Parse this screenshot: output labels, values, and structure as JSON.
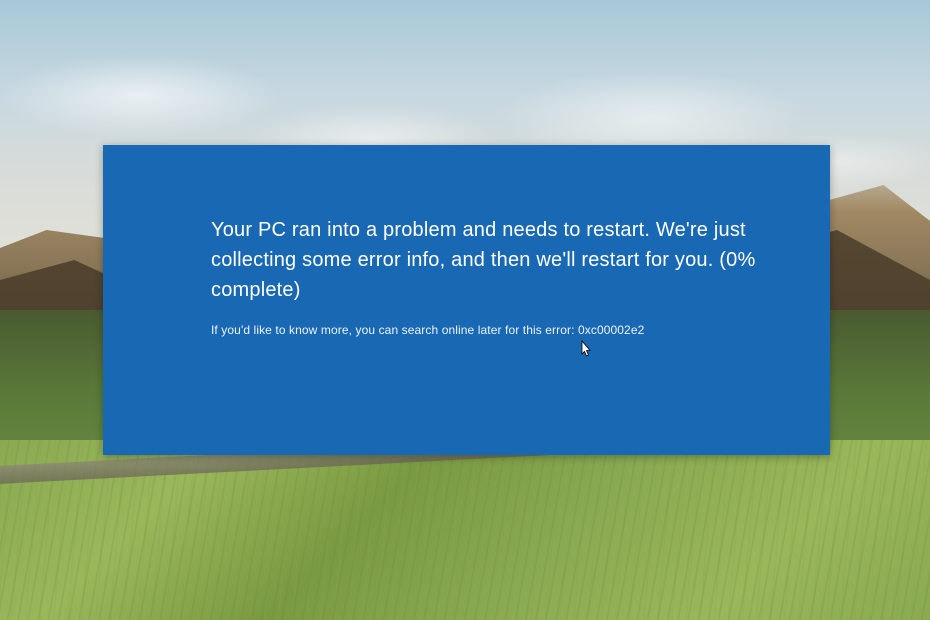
{
  "bsod": {
    "main_message": "Your PC ran into a problem and needs to restart. We're just collecting some error info, and then we'll restart for you. (0% complete)",
    "sub_message": "If you'd like to know more, you can search online later for this error: 0xc00002e2"
  }
}
